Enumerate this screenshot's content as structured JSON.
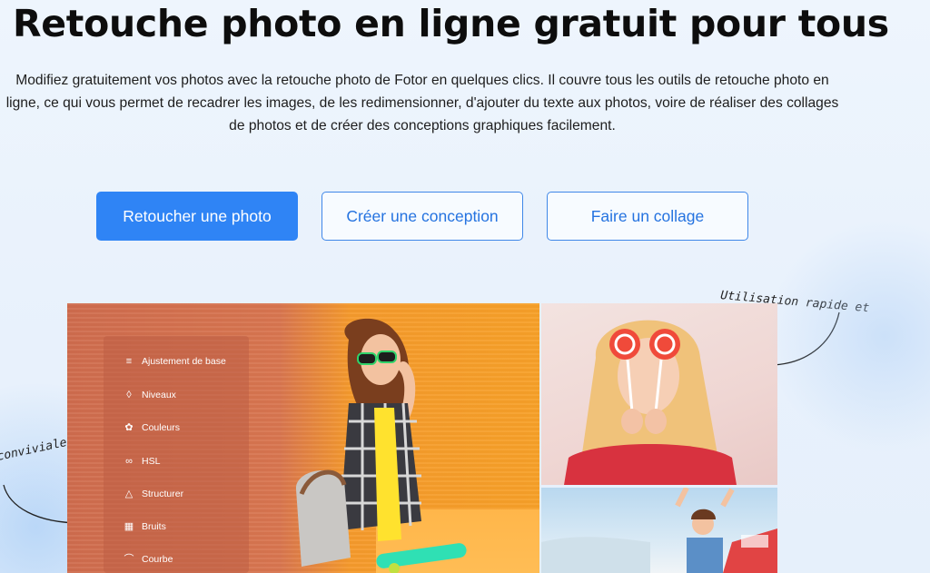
{
  "header": {
    "title": "Retouche photo en ligne gratuit pour tous",
    "description": "Modifiez gratuitement vos photos avec la retouche photo de Fotor en quelques clics. Il couvre tous les outils de retouche photo en ligne, ce qui vous permet de recadrer les images, de les redimensionner, d'ajouter du texte aux photos, voire de réaliser des collages de photos et de créer des conceptions graphiques facilement."
  },
  "buttons": {
    "primary": "Retoucher une photo",
    "design": "Créer une conception",
    "collage": "Faire un collage"
  },
  "annotations": {
    "right": "Utilisation rapide et gratuite",
    "left": "conviviale"
  },
  "editor_menu": {
    "items": [
      {
        "label": "Ajustement de base",
        "icon": "sliders-icon"
      },
      {
        "label": "Niveaux",
        "icon": "drop-icon"
      },
      {
        "label": "Couleurs",
        "icon": "palette-icon"
      },
      {
        "label": "HSL",
        "icon": "hsl-icon"
      },
      {
        "label": "Structurer",
        "icon": "triangle-icon"
      },
      {
        "label": "Bruits",
        "icon": "noise-icon"
      },
      {
        "label": "Courbe",
        "icon": "curve-icon"
      }
    ]
  },
  "colors": {
    "primary": "#2f84f5",
    "outline": "#3f87e8",
    "photo_left": "#d8754f",
    "photo_right": "#f7a028"
  }
}
